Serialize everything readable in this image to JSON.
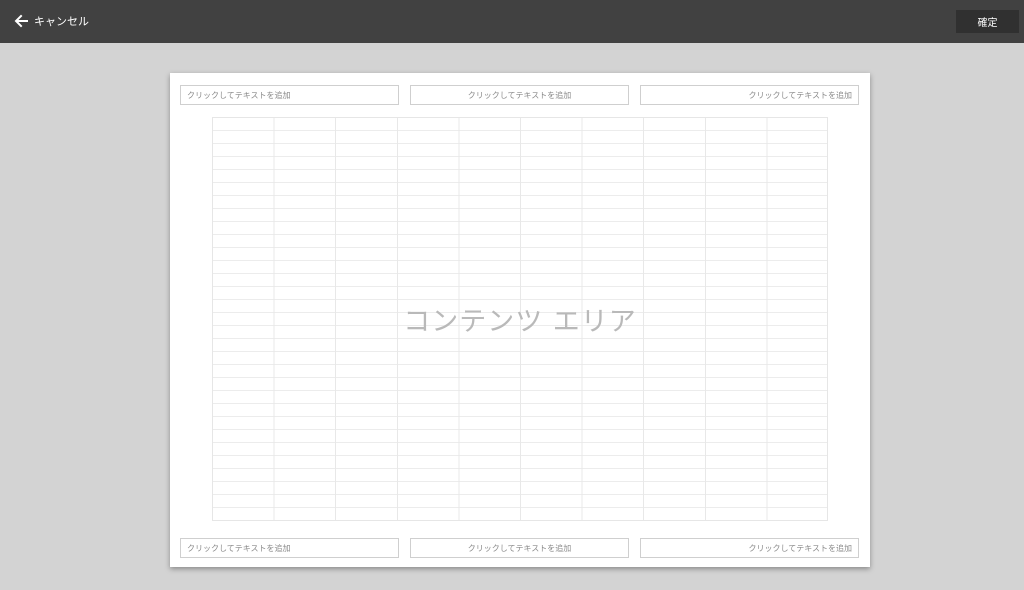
{
  "toolbar": {
    "cancel_label": "キャンセル",
    "confirm_label": "確定"
  },
  "header": {
    "left": "クリックしてテキストを追加",
    "center": "クリックしてテキストを追加",
    "right": "クリックしてテキストを追加"
  },
  "content": {
    "label": "コンテンツ エリア"
  },
  "footer": {
    "left": "クリックしてテキストを追加",
    "center": "クリックしてテキストを追加",
    "right": "クリックしてテキストを追加"
  }
}
